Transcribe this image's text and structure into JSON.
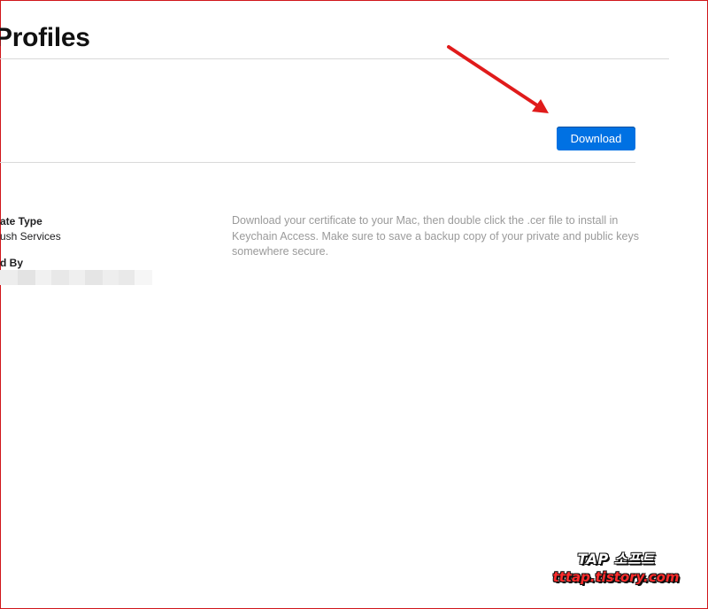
{
  "header": {
    "title": "Profiles"
  },
  "actions": {
    "download_label": "Download"
  },
  "details": {
    "certificate_type_label": "ate Type",
    "certificate_type_value": "ush Services",
    "created_by_label": "d By"
  },
  "help": {
    "text": "Download your certificate to your Mac, then double click the .cer file to install in Keychain Access. Make sure to save a backup copy of your private and public keys somewhere secure."
  },
  "watermark": {
    "line1": "TAP 소프트",
    "line2": "tttap.tistory.com"
  },
  "colors": {
    "accent": "#0071e3",
    "annotation_arrow": "#e01b1b",
    "frame_border": "#d0161b",
    "help_text": "#9a9a9a"
  },
  "icons": {
    "annotation": "red-arrow"
  }
}
